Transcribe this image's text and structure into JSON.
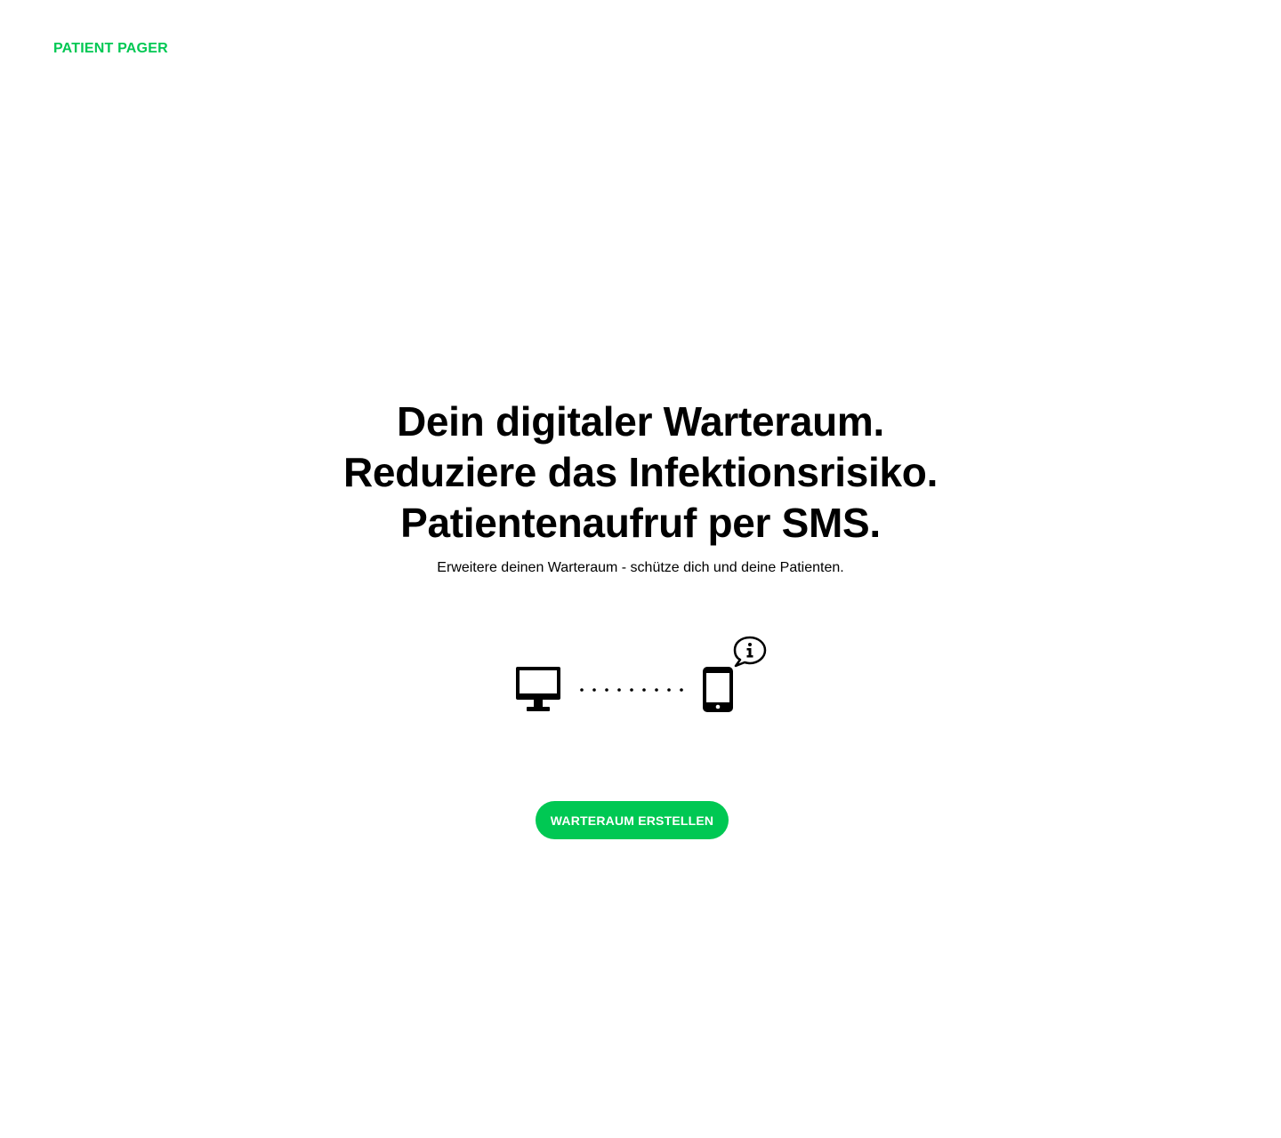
{
  "header": {
    "logo_text": "PATIENT PAGER",
    "brand_color": "#00c853"
  },
  "hero": {
    "headline_lines": [
      "Dein digitaler Warteraum.",
      "Reduziere das Infektionsrisiko.",
      "Patientenaufruf per SMS."
    ],
    "subline": "Erweitere deinen Warteraum - schütze dich und deine Patienten."
  },
  "illustration": {
    "icons": [
      "desktop-monitor-icon",
      "dotted-connection",
      "smartphone-icon",
      "info-speech-bubble-icon"
    ]
  },
  "cta": {
    "label": "WARTERAUM ERSTELLEN",
    "color": "#00c853"
  }
}
